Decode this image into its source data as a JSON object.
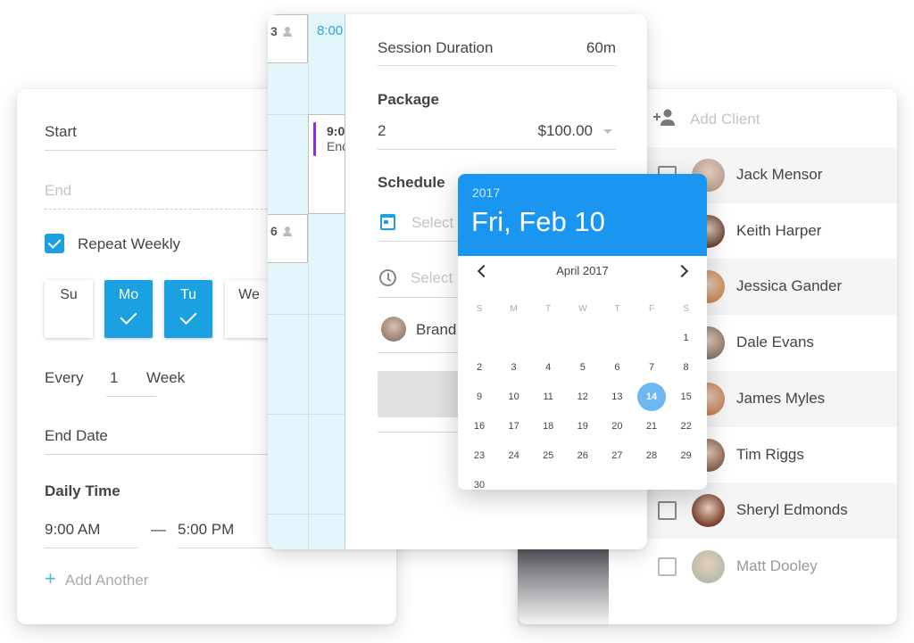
{
  "recurrence": {
    "start_label": "Start",
    "end_placeholder": "End",
    "repeat_weekly": {
      "label": "Repeat Weekly",
      "checked": true
    },
    "days": [
      {
        "label": "Su",
        "selected": false
      },
      {
        "label": "Mo",
        "selected": true
      },
      {
        "label": "Tu",
        "selected": true
      },
      {
        "label": "We",
        "selected": false
      }
    ],
    "every_label": "Every",
    "every_value": "1",
    "every_unit": "Week",
    "end_date_label": "End Date",
    "daily_time_title": "Daily Time",
    "time_from": "9:00 AM",
    "time_separator": "—",
    "time_to": "5:00 PM",
    "add_another_label": "Add Another",
    "add_icon": "plus-icon"
  },
  "schedule_strip": {
    "slots": [
      {
        "count": "3",
        "icon": "person-icon"
      },
      {
        "count": "6",
        "icon": "person-icon"
      }
    ],
    "top_time": "8:00",
    "event": {
      "time": "9:0",
      "title": "End"
    },
    "event_color": "#8a2be2"
  },
  "session": {
    "duration_label": "Session Duration",
    "duration_value": "60m",
    "package_title": "Package",
    "package_qty": "2",
    "package_price": "$100.00",
    "schedule_title": "Schedule",
    "date_placeholder": "Select",
    "time_placeholder": "Select",
    "instructor_name": "Brand"
  },
  "date_picker": {
    "year": "2017",
    "selected_label": "Fri, Feb 10",
    "month_label": "April 2017",
    "weekdays": [
      "S",
      "M",
      "T",
      "W",
      "T",
      "F",
      "S"
    ],
    "first_weekday_index": 6,
    "days_in_month": 30,
    "highlighted_day": 14,
    "accent": "#1a96f0"
  },
  "clients": {
    "add_client_label": "Add Client",
    "add_icon": "person-add-icon",
    "list": [
      {
        "name": "Jack Mensor",
        "checked": false,
        "avatar_color": "#b9a394"
      },
      {
        "name": "Keith Harper",
        "checked": false,
        "avatar_color": "#6b4a3a"
      },
      {
        "name": "Jessica Gander",
        "checked": false,
        "avatar_color": "#c98a55"
      },
      {
        "name": "Dale Evans",
        "checked": false,
        "avatar_color": "#8d7a6b"
      },
      {
        "name": "James Myles",
        "checked": false,
        "avatar_color": "#c6845e"
      },
      {
        "name": "Tim Riggs",
        "checked": false,
        "avatar_color": "#8b6650"
      },
      {
        "name": "Sheryl Edmonds",
        "checked": false,
        "avatar_color": "#7a3f2c"
      },
      {
        "name": "Matt Dooley",
        "checked": false,
        "avatar_color": "#b6bca8"
      }
    ]
  },
  "colors": {
    "primary": "#1ba1e2",
    "picker_header": "#1a96f0",
    "selected_day": "#6bb8f3",
    "strip_bg": "#e2f6fc"
  }
}
